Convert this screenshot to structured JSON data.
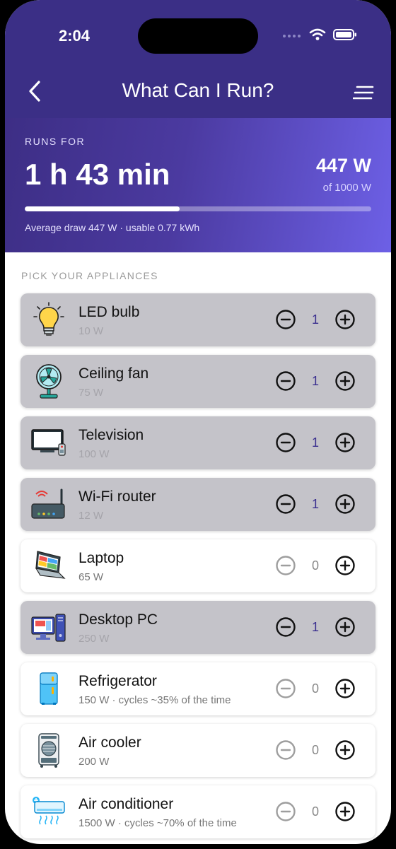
{
  "status": {
    "time": "2:04"
  },
  "nav": {
    "title": "What Can I Run?"
  },
  "summary": {
    "runs_label": "RUNS FOR",
    "runs_value": "1 h 43 min",
    "watts": "447 W",
    "of_watts": "of 1000 W",
    "load_fraction": 0.447,
    "avg_text": "Average draw 447 W · usable 0.77 kWh"
  },
  "list_label": "PICK YOUR APPLIANCES",
  "appliances": [
    {
      "name": "LED bulb",
      "watt": "10 W",
      "qty": "1",
      "icon": "bulb-icon"
    },
    {
      "name": "Ceiling fan",
      "watt": "75 W",
      "qty": "1",
      "icon": "fan-icon"
    },
    {
      "name": "Television",
      "watt": "100 W",
      "qty": "1",
      "icon": "tv-icon"
    },
    {
      "name": "Wi-Fi router",
      "watt": "12 W",
      "qty": "1",
      "icon": "router-icon"
    },
    {
      "name": "Laptop",
      "watt": "65 W",
      "qty": "0",
      "icon": "laptop-icon"
    },
    {
      "name": "Desktop PC",
      "watt": "250 W",
      "qty": "1",
      "icon": "desktop-pc-icon"
    },
    {
      "name": "Refrigerator",
      "watt": "150 W · cycles ~35% of the time",
      "qty": "0",
      "icon": "refrigerator-icon"
    },
    {
      "name": "Air cooler",
      "watt": "200 W",
      "qty": "0",
      "icon": "air-cooler-icon"
    },
    {
      "name": "Air conditioner",
      "watt": "1500 W · cycles ~70% of the time",
      "qty": "0",
      "icon": "air-conditioner-icon"
    }
  ],
  "colors": {
    "header": "#3b2f86",
    "accent": "#6d60e6",
    "selected_card": "#c4c3c9",
    "qty_active": "#3a2f8f"
  }
}
